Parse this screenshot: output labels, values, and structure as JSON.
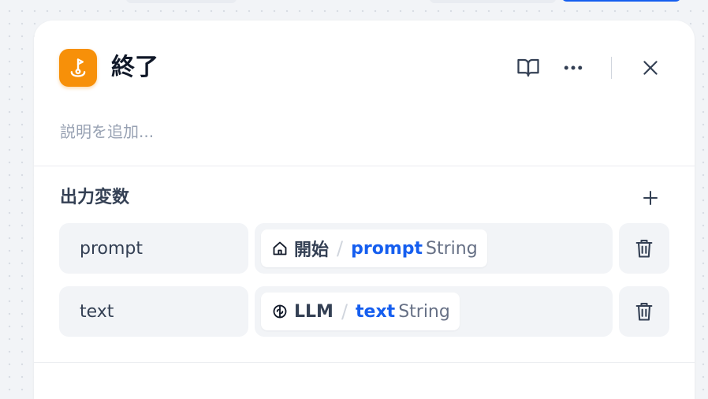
{
  "node": {
    "title": "終了",
    "description_placeholder": "説明を追加..."
  },
  "header": {
    "icons": {
      "app": "end-node-icon",
      "docs": "book-open-icon",
      "more": "more-horizontal-icon",
      "close": "close-icon"
    }
  },
  "output_section": {
    "title": "出力変数",
    "add_icon": "plus-icon",
    "variables": [
      {
        "name": "prompt",
        "source_icon": "home-icon",
        "source": "開始",
        "separator": "/",
        "variable": "prompt",
        "type": "String"
      },
      {
        "name": "text",
        "source_icon": "llm-icon",
        "source": "LLM",
        "separator": "/",
        "variable": "text",
        "type": "String"
      }
    ],
    "delete_icon": "trash-icon"
  },
  "colors": {
    "accent": "#155eef",
    "node_icon_bg": "#f79009",
    "canvas_bg": "#f2f4f7"
  }
}
